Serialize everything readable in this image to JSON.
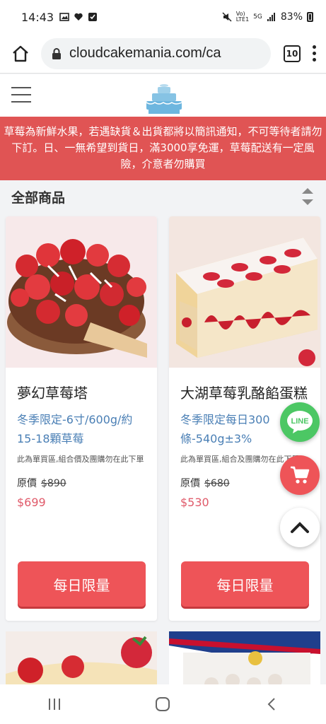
{
  "status_bar": {
    "time": "14:43",
    "battery": "83%"
  },
  "browser": {
    "url": "cloudcakemania.com/ca",
    "tab_count": "10"
  },
  "notice": {
    "text": "草莓為新鮮水果，若遇缺貨＆出貨都將以簡訊通知，不可等待者請勿下訂。日、一無希望到貨日，滿3000享免運，草莓配送有一定風險，介意者勿購買"
  },
  "section": {
    "title": "全部商品"
  },
  "products": [
    {
      "title": "夢幻草莓塔",
      "subtitle": "冬季限定-6寸/600g/約15-18顆草莓",
      "note": "此為單買區,組合價及團購勿在此下單",
      "orig_label": "原價",
      "orig_price": "$890",
      "price": "$699",
      "button": "每日限量"
    },
    {
      "title": "大湖草莓乳酪餡蛋糕",
      "subtitle": "冬季限定每日300條-540g±3%",
      "note": "此為單買區,組合及團購勿在此下單",
      "orig_label": "原價",
      "orig_price": "$680",
      "price": "$530",
      "button": "每日限量"
    }
  ],
  "fab": {
    "line_label": "LINE"
  },
  "colors": {
    "brand_red": "#ee5458",
    "notice_red": "#e05454",
    "price_red": "#e05a6a",
    "subtitle_blue": "#4a7fb5",
    "line_green": "#4cc764"
  }
}
